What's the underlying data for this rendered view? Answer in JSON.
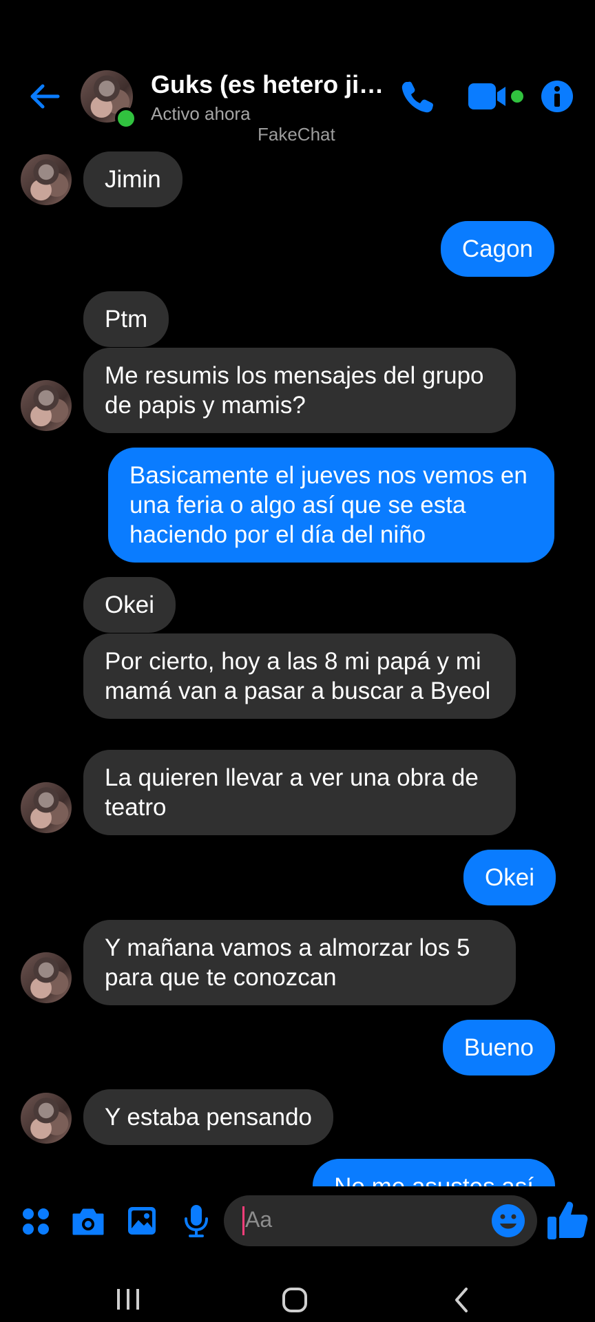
{
  "header": {
    "title": "Guks (es hetero jim...",
    "status": "Activo ahora",
    "watermark": "FakeChat"
  },
  "composer": {
    "placeholder": "Aa"
  },
  "colors": {
    "accent": "#0a7cff",
    "incoming_bubble": "#303030",
    "online": "#31c23f",
    "background": "#000000"
  },
  "icons": {
    "header": [
      "back-arrow-icon",
      "phone-icon",
      "video-camera-icon",
      "info-icon"
    ],
    "composer": [
      "apps-icon",
      "camera-icon",
      "gallery-icon",
      "microphone-icon",
      "emoji-icon",
      "thumbs-up-icon"
    ],
    "navigation": [
      "recent-apps-icon",
      "home-icon",
      "back-icon"
    ]
  },
  "messages": [
    {
      "from": "them",
      "text": "Jimin"
    },
    {
      "from": "me",
      "text": "Cagon"
    },
    {
      "from": "them",
      "text": "Ptm"
    },
    {
      "from": "them",
      "text": "Me resumis los mensajes del grupo de papis y mamis?"
    },
    {
      "from": "me",
      "text": "Basicamente el jueves nos vemos en una feria o algo así que se esta haciendo por el día del niño"
    },
    {
      "from": "them",
      "text": "Okei"
    },
    {
      "from": "them",
      "text": "Por cierto, hoy a las 8 mi papá y mi mamá van a pasar a buscar a Byeol"
    },
    {
      "from": "them",
      "text": "La quieren llevar a ver una obra de teatro"
    },
    {
      "from": "me",
      "text": "Okei"
    },
    {
      "from": "them",
      "text": "Y mañana vamos a almorzar los 5 para que te conozcan"
    },
    {
      "from": "me",
      "text": "Bueno"
    },
    {
      "from": "them",
      "text": "Y estaba pensando"
    },
    {
      "from": "me",
      "text": "No me asustes así"
    }
  ]
}
